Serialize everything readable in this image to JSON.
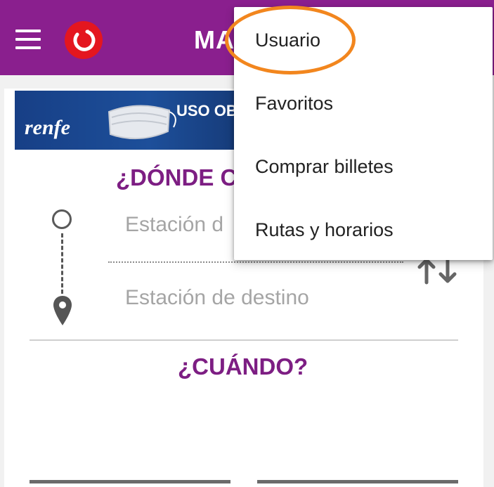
{
  "appbar": {
    "title": "MA",
    "menu_icon": "hamburger-menu-icon",
    "logo": "renfe-logo-icon"
  },
  "banner": {
    "brand": "renfe",
    "text": "USO OB"
  },
  "search": {
    "where_title": "¿DÓNDE C",
    "origin_placeholder": "Estación d",
    "destination_placeholder": "Estación de destino",
    "when_title": "¿CUÁNDO?"
  },
  "overflow_menu": {
    "items": [
      {
        "label": "Usuario"
      },
      {
        "label": "Favoritos"
      },
      {
        "label": "Comprar billetes"
      },
      {
        "label": "Rutas y horarios"
      }
    ]
  },
  "colors": {
    "appbar": "#8a1f8e",
    "section_title": "#7d1e83",
    "highlight": "#f2861e"
  }
}
